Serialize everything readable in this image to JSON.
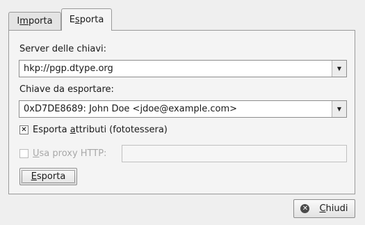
{
  "tabs": [
    {
      "pre": "I",
      "u": "m",
      "post": "porta"
    },
    {
      "pre": "E",
      "u": "s",
      "post": "porta"
    }
  ],
  "server_label": "Server delle chiavi:",
  "server_value": "hkp://pgp.dtype.org",
  "key_label": "Chiave da esportare:",
  "key_value": "0xD7DE8689: John Doe <jdoe@example.com>",
  "attributes": {
    "pre": "Esporta ",
    "u": "a",
    "post": "ttributi (fototessera)",
    "checked_mark": "✕"
  },
  "proxy": {
    "pre": "",
    "u": "U",
    "post": "sa proxy HTTP:",
    "value": ""
  },
  "export_button": {
    "pre": "",
    "u": "E",
    "post": "sporta"
  },
  "close_button": {
    "pre": "",
    "u": "C",
    "post": "hiudi",
    "icon": "✕"
  },
  "combo_arrow": "▼"
}
